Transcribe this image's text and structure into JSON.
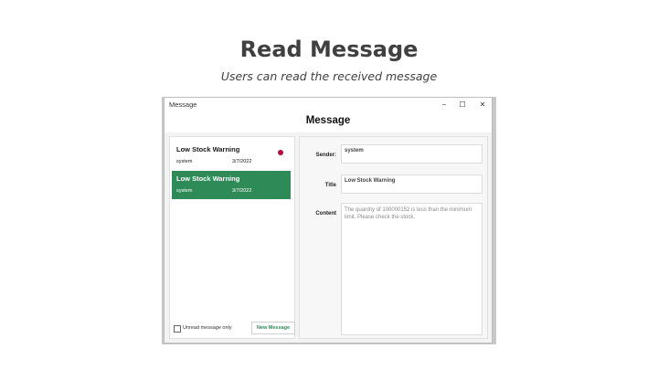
{
  "slide": {
    "title": "Read Message",
    "subtitle": "Users can read the received message"
  },
  "window": {
    "title": "Message",
    "minimize_glyph": "−",
    "maximize_glyph": "☐",
    "close_glyph": "✕"
  },
  "app": {
    "title": "Message"
  },
  "messages": [
    {
      "title": "Low Stock Warning",
      "sender": "system",
      "date": "3/7/2022",
      "unread": true,
      "selected": false
    },
    {
      "title": "Low Stock Warning",
      "sender": "system",
      "date": "3/7/2022",
      "unread": false,
      "selected": true
    }
  ],
  "footer": {
    "unread_only_label": "Unread message only",
    "unread_only_checked": false,
    "new_message_label": "New Message"
  },
  "detail": {
    "sender_label": "Sender:",
    "sender_value": "system",
    "title_label": "Title",
    "title_value": "Low Stock Warning",
    "content_label": "Content",
    "content_value": "The quantity of 100000152 is less than the minimum limit. Please check the stock."
  },
  "colors": {
    "accent_green": "#2e8b57",
    "unread_dot": "#b0103a"
  }
}
